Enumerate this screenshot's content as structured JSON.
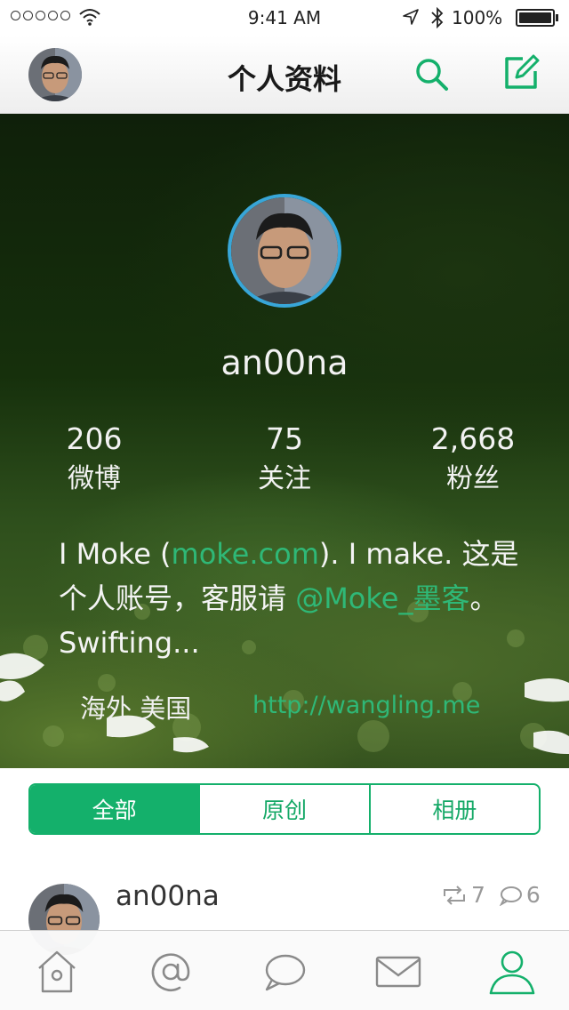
{
  "status_bar": {
    "time": "9:41 AM",
    "battery_text": "100%",
    "battery_level": 1.0
  },
  "nav": {
    "title": "个人资料",
    "icons": {
      "avatar": "user-avatar",
      "search": "search-icon",
      "compose": "compose-icon"
    }
  },
  "profile": {
    "username": "an00na",
    "stats": [
      {
        "value": "206",
        "label": "微博"
      },
      {
        "value": "75",
        "label": "关注"
      },
      {
        "value": "2,668",
        "label": "粉丝"
      }
    ],
    "bio": {
      "text_1": "I Moke (",
      "link_1": "moke.com",
      "text_2": "). I make. 这是个人账号，客服请 ",
      "link_2": "@Moke_墨客",
      "text_3": "。Swifting..."
    },
    "location": "海外 美国",
    "website": "http://wangling.me"
  },
  "segments": [
    {
      "label": "全部",
      "active": true
    },
    {
      "label": "原创",
      "active": false
    },
    {
      "label": "相册",
      "active": false
    }
  ],
  "feed": {
    "author": "an00na",
    "reposts": "7",
    "comments": "6"
  },
  "tabbar": {
    "tabs": [
      {
        "icon": "home-icon",
        "active": false
      },
      {
        "icon": "at-icon",
        "active": false
      },
      {
        "icon": "chat-bubble-icon",
        "active": false
      },
      {
        "icon": "mail-icon",
        "active": false
      },
      {
        "icon": "person-icon",
        "active": true
      }
    ]
  },
  "colors": {
    "accent": "#14b06b",
    "link": "#2fb877",
    "avatar_ring": "#38a6d8",
    "icon_gray": "#8a8a8a"
  }
}
